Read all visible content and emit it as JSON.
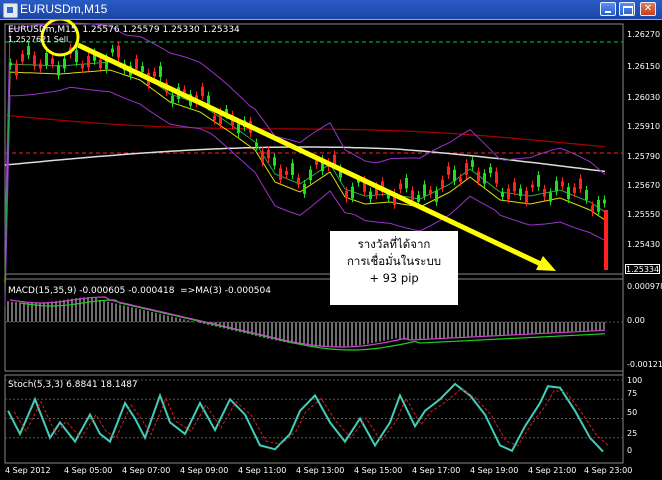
{
  "window": {
    "title": "EURUSDm,M15"
  },
  "main_panel": {
    "header": "EURUSDm,M15  1.25576 1.25579 1.25330 1.25334",
    "sell_label": "1.2527621 Sell",
    "price_labels": [
      "1.26270",
      "1.26150",
      "1.26030",
      "1.25910",
      "1.25790",
      "1.25670",
      "1.25550",
      "1.25430"
    ],
    "current_price": "1.25334"
  },
  "annotation": {
    "line1": "รางวัลที่ได้จาก",
    "line2": "การเชื่อมั่นในระบบ",
    "line3": "+ 93 pip"
  },
  "macd_panel": {
    "header": "MACD(15,35,9) -0.000605 -0.000418  =>MA(3) -0.000504",
    "scale_top": "0.000978",
    "scale_mid": "0.00",
    "scale_bottom": "-0.00121"
  },
  "stoch_panel": {
    "header": "Stoch(5,3,3) 6.8841 18.1487",
    "levels": [
      "100",
      "75",
      "50",
      "25",
      "0"
    ]
  },
  "time_axis": [
    "4 Sep 2012",
    "4 Sep 05:00",
    "4 Sep 07:00",
    "4 Sep 09:00",
    "4 Sep 11:00",
    "4 Sep 13:00",
    "4 Sep 15:00",
    "4 Sep 17:00",
    "4 Sep 19:00",
    "4 Sep 21:00",
    "4 Sep 23:00"
  ],
  "colors": {
    "bull_candle": "#22dd22",
    "bear_candle": "#ff2222",
    "arrow": "#ffff00",
    "bollinger": "#9933cc",
    "ma_yellow": "#dddd00",
    "ma_red": "#aa0000",
    "ma_white": "#dddddd",
    "stoch_main": "#44ccbb",
    "stoch_signal": "#cc2222",
    "level_green": "#00cc44"
  }
}
